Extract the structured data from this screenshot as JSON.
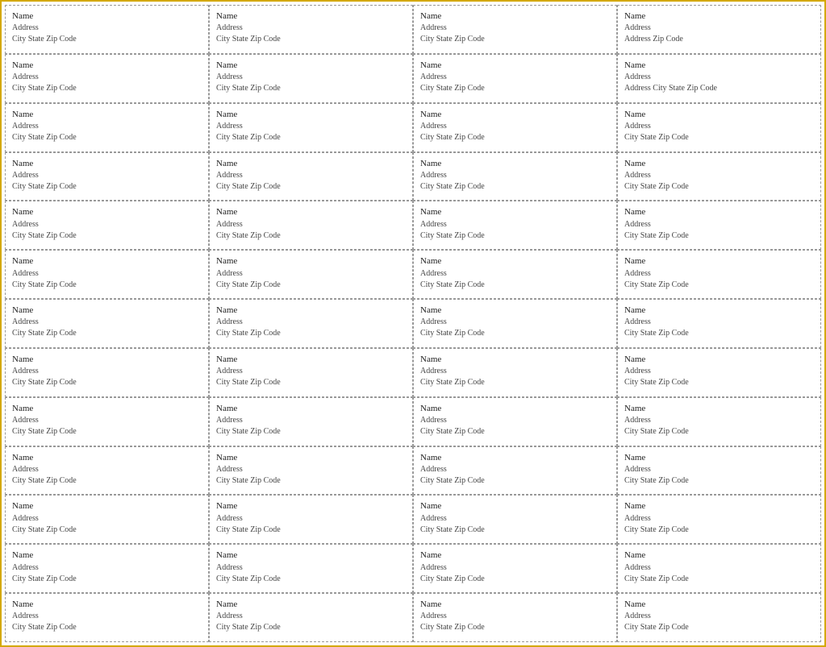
{
  "page": {
    "border_color": "#d4a800",
    "columns": 4,
    "rows": 13
  },
  "label": {
    "name": "Name",
    "address": "Address",
    "city_state_zip": "City State  Zip Code"
  },
  "labels": [
    {
      "name": "Name",
      "address": "Address",
      "city_state_zip": "City State  Zip Code"
    },
    {
      "name": "Name",
      "address": "Address",
      "city_state_zip": "City State  Zip Code"
    },
    {
      "name": "Name",
      "address": "Address",
      "city_state_zip": "City State  Zip Code"
    },
    {
      "name": "Name",
      "address": "Address",
      "city_state_zip": "Address Zip Code"
    },
    {
      "name": "Name",
      "address": "Address",
      "city_state_zip": "City State  Zip Code"
    },
    {
      "name": "Name",
      "address": "Address",
      "city_state_zip": "City State  Zip Code"
    },
    {
      "name": "Name",
      "address": "Address",
      "city_state_zip": "City State  Zip Code"
    },
    {
      "name": "Name",
      "address": "Address",
      "city_state_zip": "Address City State Zip Code"
    },
    {
      "name": "Name",
      "address": "Address",
      "city_state_zip": "City State  Zip Code"
    },
    {
      "name": "Name",
      "address": "Address",
      "city_state_zip": "City State  Zip Code"
    },
    {
      "name": "Name",
      "address": "Address",
      "city_state_zip": "City State  Zip Code"
    },
    {
      "name": "Name",
      "address": "Address",
      "city_state_zip": "City State  Zip Code"
    },
    {
      "name": "Name",
      "address": "Address",
      "city_state_zip": "City State  Zip Code"
    },
    {
      "name": "Name",
      "address": "Address",
      "city_state_zip": "City State  Zip Code"
    },
    {
      "name": "Name",
      "address": "Address",
      "city_state_zip": "City State  Zip Code"
    },
    {
      "name": "Name",
      "address": "Address",
      "city_state_zip": "City State  Zip Code"
    },
    {
      "name": "Name",
      "address": "Address",
      "city_state_zip": "City State  Zip Code"
    },
    {
      "name": "Name",
      "address": "Address",
      "city_state_zip": "City State  Zip Code"
    },
    {
      "name": "Name",
      "address": "Address",
      "city_state_zip": "City State  Zip Code"
    },
    {
      "name": "Name",
      "address": "Address",
      "city_state_zip": "City State  Zip Code"
    },
    {
      "name": "Name",
      "address": "Address",
      "city_state_zip": "City State  Zip Code"
    },
    {
      "name": "Name",
      "address": "Address",
      "city_state_zip": "City State  Zip Code"
    },
    {
      "name": "Name",
      "address": "Address",
      "city_state_zip": "City State  Zip Code"
    },
    {
      "name": "Name",
      "address": "Address",
      "city_state_zip": "City State  Zip Code"
    },
    {
      "name": "Name",
      "address": "Address",
      "city_state_zip": "City State  Zip Code"
    },
    {
      "name": "Name",
      "address": "Address",
      "city_state_zip": "City State  Zip Code"
    },
    {
      "name": "Name",
      "address": "Address",
      "city_state_zip": "City State  Zip Code"
    },
    {
      "name": "Name",
      "address": "Address",
      "city_state_zip": "City State  Zip Code"
    },
    {
      "name": "Name",
      "address": "Address",
      "city_state_zip": "City State  Zip Code"
    },
    {
      "name": "Name",
      "address": "Address",
      "city_state_zip": "City State  Zip Code"
    },
    {
      "name": "Name",
      "address": "Address",
      "city_state_zip": "City State  Zip Code"
    },
    {
      "name": "Name",
      "address": "Address",
      "city_state_zip": "City State  Zip Code"
    },
    {
      "name": "Name",
      "address": "Address",
      "city_state_zip": "City State  Zip Code"
    },
    {
      "name": "Name",
      "address": "Address",
      "city_state_zip": "City State  Zip Code"
    },
    {
      "name": "Name",
      "address": "Address",
      "city_state_zip": "City State  Zip Code"
    },
    {
      "name": "Name",
      "address": "Address",
      "city_state_zip": "City State  Zip Code"
    },
    {
      "name": "Name",
      "address": "Address",
      "city_state_zip": "City State  Zip Code"
    },
    {
      "name": "Name",
      "address": "Address",
      "city_state_zip": "City State  Zip Code"
    },
    {
      "name": "Name",
      "address": "Address",
      "city_state_zip": "City State  Zip Code"
    },
    {
      "name": "Name",
      "address": "Address",
      "city_state_zip": "City State  Zip Code"
    },
    {
      "name": "Name",
      "address": "Address",
      "city_state_zip": "City State  Zip Code"
    },
    {
      "name": "Name",
      "address": "Address",
      "city_state_zip": "City State  Zip Code"
    },
    {
      "name": "Name",
      "address": "Address",
      "city_state_zip": "City State  Zip Code"
    },
    {
      "name": "Name",
      "address": "Address",
      "city_state_zip": "City State  Zip Code"
    },
    {
      "name": "Name",
      "address": "Address",
      "city_state_zip": "City State  Zip Code"
    },
    {
      "name": "Name",
      "address": "Address",
      "city_state_zip": "City State  Zip Code"
    },
    {
      "name": "Name",
      "address": "Address",
      "city_state_zip": "City State  Zip Code"
    },
    {
      "name": "Name",
      "address": "Address",
      "city_state_zip": "City State  Zip Code"
    },
    {
      "name": "Name",
      "address": "Address",
      "city_state_zip": "City State  Zip Code"
    },
    {
      "name": "Name",
      "address": "Address",
      "city_state_zip": "City State  Zip Code"
    },
    {
      "name": "Name",
      "address": "Address",
      "city_state_zip": "City State  Zip Code"
    },
    {
      "name": "Name",
      "address": "Address",
      "city_state_zip": "City State  Zip Code"
    }
  ]
}
